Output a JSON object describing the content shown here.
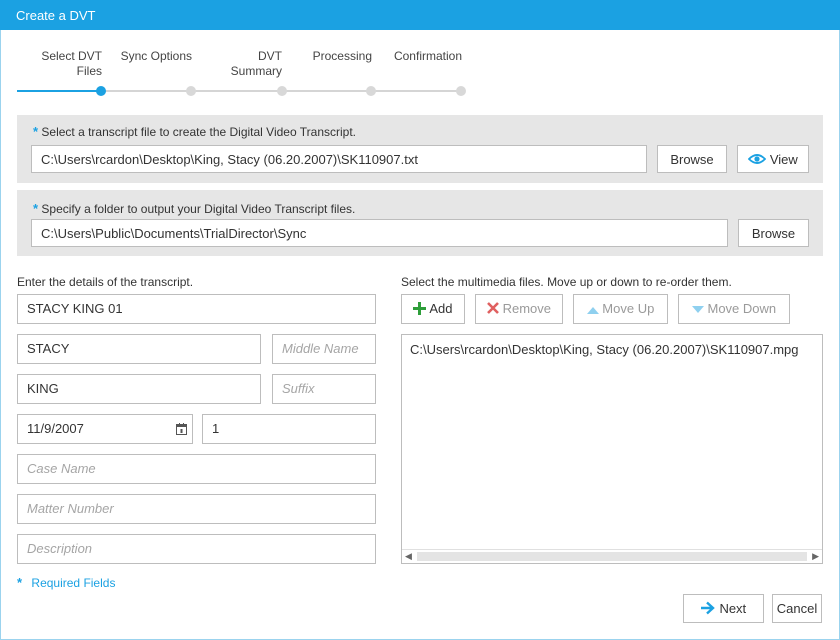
{
  "window": {
    "title": "Create a DVT"
  },
  "wizard": {
    "steps": [
      {
        "label_line1": "Select DVT",
        "label_line2": "Files"
      },
      {
        "label_line1": "Sync Options",
        "label_line2": ""
      },
      {
        "label_line1": "DVT",
        "label_line2": "Summary"
      },
      {
        "label_line1": "Processing",
        "label_line2": ""
      },
      {
        "label_line1": "Confirmation",
        "label_line2": ""
      }
    ],
    "active_step": 1
  },
  "transcript_file": {
    "required_marker": "*",
    "label": "Select a transcript file to create the Digital Video Transcript.",
    "value": "C:\\Users\\rcardon\\Desktop\\King, Stacy (06.20.2007)\\SK110907.txt",
    "browse_label": "Browse",
    "view_label": "View"
  },
  "output_folder": {
    "required_marker": "*",
    "label": "Specify a folder to output your Digital Video Transcript files.",
    "value": "C:\\Users\\Public\\Documents\\TrialDirector\\Sync",
    "browse_label": "Browse"
  },
  "details": {
    "label": "Enter the details of the transcript.",
    "transcript_name": "STACY KING 01",
    "first_name": "STACY",
    "middle_name_placeholder": "Middle Name",
    "last_name": "KING",
    "suffix_placeholder": "Suffix",
    "date": "11/9/2007",
    "volume": "1",
    "case_name_placeholder": "Case Name",
    "matter_number_placeholder": "Matter Number",
    "description_placeholder": "Description"
  },
  "multimedia": {
    "label": "Select the multimedia files. Move up or down to re-order them.",
    "add_label": "Add",
    "remove_label": "Remove",
    "move_up_label": "Move Up",
    "move_down_label": "Move Down",
    "files": [
      "C:\\Users\\rcardon\\Desktop\\King, Stacy (06.20.2007)\\SK110907.mpg"
    ]
  },
  "footer": {
    "required_marker": "*",
    "required_note": "Required Fields",
    "next_label": "Next",
    "cancel_label": "Cancel"
  },
  "colors": {
    "accent": "#1ba1e2",
    "add_green": "#2e9e3a",
    "remove_red": "#e06060"
  }
}
